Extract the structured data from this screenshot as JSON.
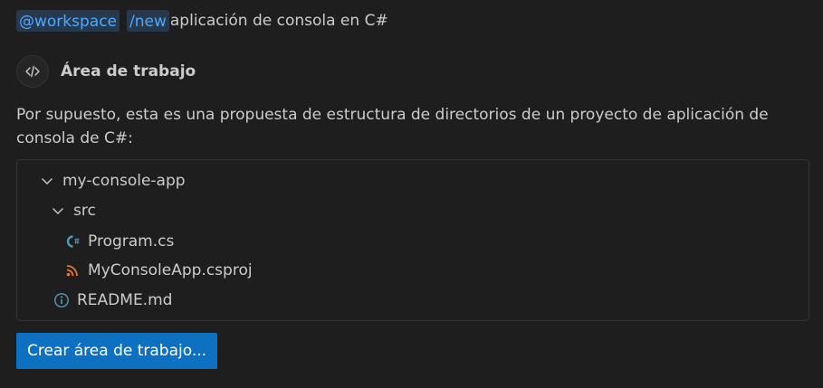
{
  "prompt": {
    "agent_chip": "@workspace",
    "command_chip": "/new",
    "text": "aplicación de consola en C#"
  },
  "response": {
    "agent_name": "Área de trabajo",
    "agent_icon": "code-icon",
    "message": "Por supuesto, esta es una propuesta de estructura de directorios de un proyecto de aplicación de consola de C#:"
  },
  "file_tree": {
    "root": {
      "label": "my-console-app",
      "expanded": true
    },
    "src_folder": {
      "label": "src",
      "expanded": true
    },
    "program_file": {
      "label": "Program.cs",
      "icon": "csharp-file-icon",
      "icon_color": "#519aba"
    },
    "csproj_file": {
      "label": "MyConsoleApp.csproj",
      "icon": "rss-icon",
      "icon_color": "#e37933"
    },
    "readme_file": {
      "label": "README.md",
      "icon": "info-icon",
      "icon_color": "#519aba"
    }
  },
  "actions": {
    "create_workspace_label": "Crear área de trabajo..."
  },
  "colors": {
    "background": "#1e1e1e",
    "chip_background": "#26394d",
    "chip_text": "#4fa8ff",
    "button_background": "#0e70c0",
    "text": "#cccccc"
  }
}
